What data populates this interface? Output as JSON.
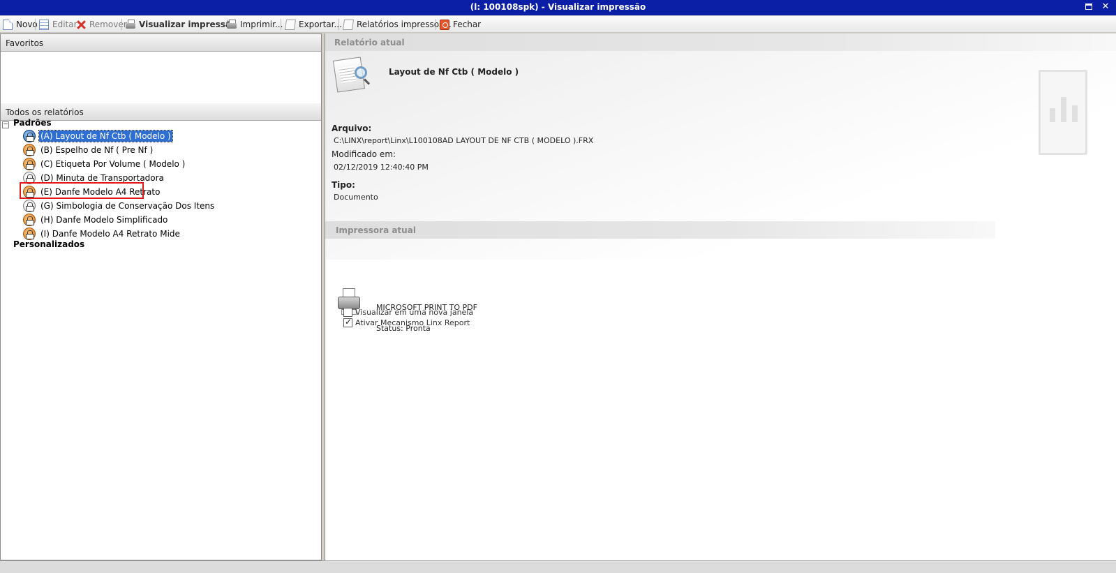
{
  "window": {
    "title": "(l: 100108spk) - Visualizar impressão",
    "maximize_icon": "maximize-icon",
    "close_icon": "close-icon",
    "close_glyph": "✕"
  },
  "toolbar": {
    "novo": "Novo",
    "editar": "Editar",
    "remover": "Remover",
    "visualizar": "Visualizar impressão",
    "imprimir": "Imprimir...",
    "exportar": "Exportar...",
    "relatorios": "Relatórios impressos...",
    "fechar": "Fechar"
  },
  "left": {
    "favoritos_header": "Favoritos",
    "todos_header": "Todos os relatórios",
    "expander_glyph": "−",
    "groups": {
      "padroes": "Padrões",
      "personalizados": "Personalizados"
    },
    "items": [
      {
        "label": "(A) Layout de Nf Ctb ( Modelo )",
        "icon": "orange-printer-icon",
        "selected": true
      },
      {
        "label": "(B) Espelho de Nf ( Pre Nf )",
        "icon": "orange-printer-icon",
        "selected": false
      },
      {
        "label": "(C) Etiqueta Por Volume ( Modelo )",
        "icon": "orange-printer-icon",
        "selected": false
      },
      {
        "label": "(D) Minuta de Transportadora",
        "icon": "white-printer-icon",
        "selected": false
      },
      {
        "label": "(E) Danfe Modelo A4 Retrato",
        "icon": "orange-printer-icon",
        "selected": false
      },
      {
        "label": "(G) Simbologia de Conservação Dos Itens",
        "icon": "white-printer-icon",
        "selected": false
      },
      {
        "label": "(H) Danfe Modelo Simplificado",
        "icon": "orange-printer-icon",
        "selected": false
      },
      {
        "label": "(I) Danfe Modelo A4 Retrato Mide",
        "icon": "orange-printer-icon",
        "selected": false
      }
    ]
  },
  "right": {
    "relatorio_header": "Relatório atual",
    "report_title": "Layout de Nf Ctb ( Modelo )",
    "arquivo_label": "Arquivo:",
    "arquivo_value": "C:\\LINX\\report\\Linx\\L100108AD LAYOUT DE NF CTB ( MODELO ).FRX",
    "modificado_label": "Modificado em:",
    "modificado_value": "02/12/2019 12:40:40 PM",
    "tipo_label": "Tipo:",
    "tipo_value": "Documento",
    "impressora_header": "Impressora atual",
    "printer_name": "MICROSOFT PRINT TO PDF",
    "status_label": "Status:",
    "status_value": "Pronta",
    "chk_nova_janela": "Visualizar em uma nova janela",
    "chk_nova_janela_checked": false,
    "chk_mecanismo": "Ativar Mecanismo Linx Report",
    "chk_mecanismo_checked": true
  },
  "colors": {
    "titlebar": "#0a1fa6",
    "selection": "#2f6fd2",
    "highlight_box": "#e01818"
  }
}
